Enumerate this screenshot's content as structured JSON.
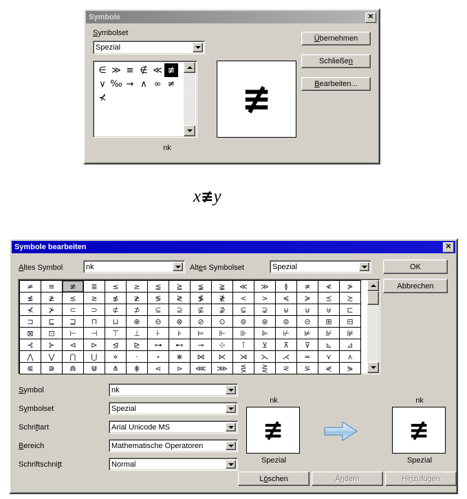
{
  "dialog1": {
    "title": "Symbole",
    "close_label": "✕",
    "symbolset_label": "Symbolset",
    "symbolset_value": "Spezial",
    "symbols": [
      "∈",
      "≫",
      "≡",
      "∉",
      "≪",
      "≢",
      "∨",
      "‰",
      "→",
      "∧",
      "∞",
      "≠",
      "⊀"
    ],
    "selected_index": 5,
    "preview_symbol": "≢",
    "preview_caption": "nk",
    "buttons": [
      {
        "label": "Übernehmen",
        "accel": "Ü",
        "enabled": true
      },
      {
        "label": "Schließen",
        "accel": "n",
        "enabled": true
      },
      {
        "label": "Bearbeiten...",
        "accel": "B",
        "enabled": true
      }
    ]
  },
  "formula": {
    "left": "x",
    "operator": "≢",
    "right": "y"
  },
  "dialog2": {
    "title": "Symbole bearbeiten",
    "close_label": "✕",
    "old_symbol_label": "Altes Symbol",
    "old_symbol_value": "nk",
    "old_symbolset_label": "Altes Symbolset",
    "old_symbolset_value": "Spezial",
    "ok_label": "OK",
    "cancel_label": "Abbrechen",
    "charmap": {
      "rows": [
        [
          "≠",
          "≡",
          "≢",
          "≣",
          "≤",
          "≥",
          "≦",
          "≧",
          "≨",
          "≩",
          "≪",
          "≫",
          "≬",
          "≭",
          "≮",
          "≯"
        ],
        [
          "≰",
          "≱",
          "≲",
          "≳",
          "≴",
          "≵",
          "≶",
          "≷",
          "≸",
          "≹",
          "<",
          ">",
          "≼",
          "≽",
          "≾",
          "≿"
        ],
        [
          "⊀",
          "⊁",
          "⊂",
          "⊃",
          "⊄",
          "⊅",
          "⊆",
          "⊇",
          "⊈",
          "⊉",
          "⊊",
          "⊋",
          "⊌",
          "⊍",
          "⊎",
          "⊏"
        ],
        [
          "⊐",
          "⊑",
          "⊒",
          "⊓",
          "⊔",
          "⊕",
          "⊖",
          "⊗",
          "⊘",
          "⊙",
          "⊚",
          "⊛",
          "⊜",
          "⊝",
          "⊞",
          "⊟"
        ],
        [
          "⊠",
          "⊡",
          "⊢",
          "⊣",
          "⊤",
          "⊥",
          "⊦",
          "⊧",
          "⊨",
          "⊩",
          "⊪",
          "⊫",
          "⊬",
          "⊭",
          "⊮",
          "⊯"
        ],
        [
          "⊰",
          "⊱",
          "⊲",
          "⊳",
          "⊴",
          "⊵",
          "⊶",
          "⊷",
          "⊸",
          "⊹",
          "⊺",
          "⊻",
          "⊼",
          "⊽",
          "⊾",
          "⊿"
        ],
        [
          "⋀",
          "⋁",
          "⋂",
          "⋃",
          "⋄",
          "⋅",
          "⋆",
          "⋇",
          "⋈",
          "⋉",
          "⋊",
          "⋋",
          "⋌",
          "⋍",
          "⋎",
          "⋏"
        ],
        [
          "⋐",
          "⋑",
          "⋒",
          "⋓",
          "⋔",
          "⋕",
          "⋖",
          "⋗",
          "⋘",
          "⋙",
          "⋚",
          "⋛",
          "⋜",
          "⋝",
          "⋞",
          "⋟"
        ]
      ],
      "selected_row": 0,
      "selected_col": 2
    },
    "fields": [
      {
        "label": "Symbol",
        "accel": "S",
        "value": "nk"
      },
      {
        "label": "Symbolset",
        "accel": "y",
        "value": "Spezial"
      },
      {
        "label": "Schriftart",
        "accel": "f",
        "value": "Arial Unicode MS"
      },
      {
        "label": "Bereich",
        "accel": "B",
        "value": "Mathematische Operatoren"
      },
      {
        "label": "Schriftschnitt",
        "accel": "t",
        "value": "Normal"
      }
    ],
    "preview_old": {
      "top_caption": "nk",
      "symbol": "≢",
      "bottom_caption": "Spezial"
    },
    "preview_new": {
      "top_caption": "nk",
      "symbol": "≢",
      "bottom_caption": "Spezial"
    },
    "arrow_icon": "right-arrow-icon",
    "bottom_buttons": [
      {
        "label": "Löschen",
        "accel": "ö",
        "enabled": true
      },
      {
        "label": "Ändern",
        "accel": "n",
        "enabled": false
      },
      {
        "label": "Hinzufügen",
        "accel": "n",
        "enabled": false
      }
    ]
  }
}
